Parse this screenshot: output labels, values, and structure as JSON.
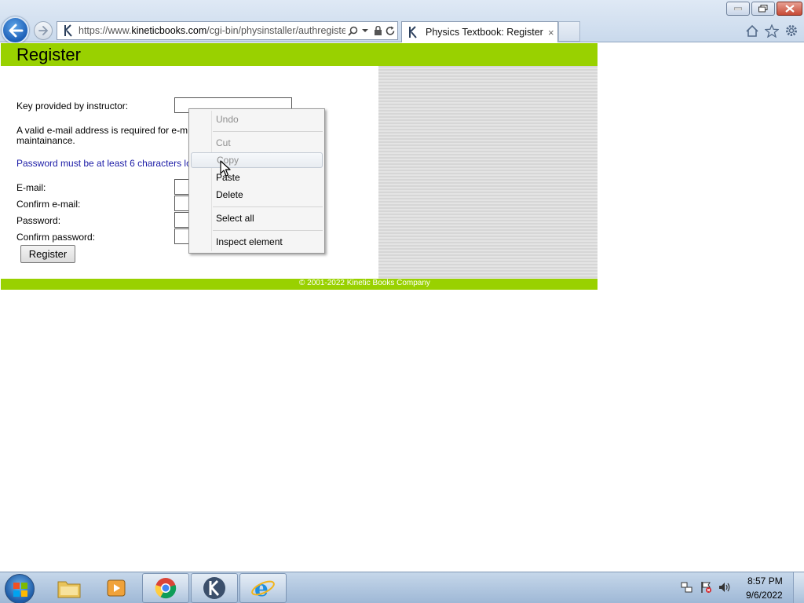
{
  "browser": {
    "address_host_prefix": "https://www.",
    "address_host": "kineticbooks.com",
    "address_path": "/cgi-bin/physinstaller/authregiste",
    "tab_title": "Physics Textbook: Register",
    "tab_close": "×"
  },
  "page": {
    "title": "Register",
    "labels": {
      "key": "Key provided by instructor:",
      "email": "E-mail:",
      "confirm_email": "Confirm e-mail:",
      "password": "Password:",
      "confirm_password": "Confirm password:"
    },
    "email_notice": "A valid e-mail address is required for e-m maintainance.",
    "password_notice": "Password must be at least 6 characters lo",
    "register_button": "Register",
    "footer": "© 2001-2022 Kinetic Books Company"
  },
  "context_menu": {
    "items": [
      {
        "label": "Undo",
        "enabled": false
      },
      {
        "label": "Cut",
        "enabled": false
      },
      {
        "label": "Copy",
        "enabled": false
      },
      {
        "label": "Paste",
        "enabled": true
      },
      {
        "label": "Delete",
        "enabled": true
      },
      {
        "label": "Select all",
        "enabled": true
      },
      {
        "label": "Inspect element",
        "enabled": true
      }
    ]
  },
  "taskbar": {
    "clock_time": "8:57 PM",
    "clock_date": "9/6/2022"
  },
  "colors": {
    "header_green": "#99d100",
    "notice_blue": "#1a1aa6"
  }
}
